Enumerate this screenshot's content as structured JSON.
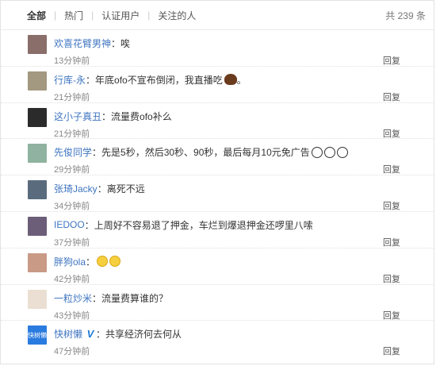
{
  "filter_bar": {
    "tabs": [
      {
        "label": "全部"
      },
      {
        "label": "热门"
      },
      {
        "label": "认证用户"
      },
      {
        "label": "关注的人"
      }
    ],
    "total": "共 239 条"
  },
  "reply_label": "回复",
  "comments": [
    {
      "user": "欢喜花臂男神",
      "colon": "：",
      "text": "唉",
      "time": "13分钟前",
      "avatar_color": "#8a6e6a"
    },
    {
      "user": "行库-永",
      "colon": "：",
      "text": "年底ofo不宣布倒闭，我直播吃",
      "suffix": "。",
      "emoji": "poop-icon",
      "time": "21分钟前",
      "avatar_color": "#a39880"
    },
    {
      "user": "这小子真丑",
      "colon": "：",
      "text": "流量费ofo补么",
      "time": "21分钟前",
      "avatar_color": "#2b2b2b"
    },
    {
      "user": "先俊同学",
      "colon": "：",
      "text": "先是5秒，然后30秒、90秒，最后每月10元免广告",
      "emoji": "shocked-face-icons",
      "time": "29分钟前",
      "avatar_color": "#8fb3a0"
    },
    {
      "user": "张琦Jacky",
      "colon": "：",
      "text": "离死不远",
      "time": "34分钟前",
      "avatar_color": "#5a6b7d"
    },
    {
      "user": "IEDOO",
      "colon": "：",
      "text": "上周好不容易退了押金，车烂到爆退押金还啰里八嗦",
      "time": "37分钟前",
      "avatar_color": "#6c5d78"
    },
    {
      "user": "胖狗ola",
      "colon": "：",
      "text": "",
      "emoji": "smile-face-icons",
      "time": "42分钟前",
      "avatar_color": "#c99a86"
    },
    {
      "user": "一粒炒米",
      "colon": "：",
      "text": "流量费算谁的？",
      "time": "43分钟前",
      "avatar_color": "#eadfd2"
    },
    {
      "user": "快树懒",
      "colon": "：",
      "text": "共享经济何去何从",
      "verified": "V",
      "avatar_label": "快树懒",
      "time": "47分钟前",
      "avatar_color": "#2a7be0"
    }
  ]
}
